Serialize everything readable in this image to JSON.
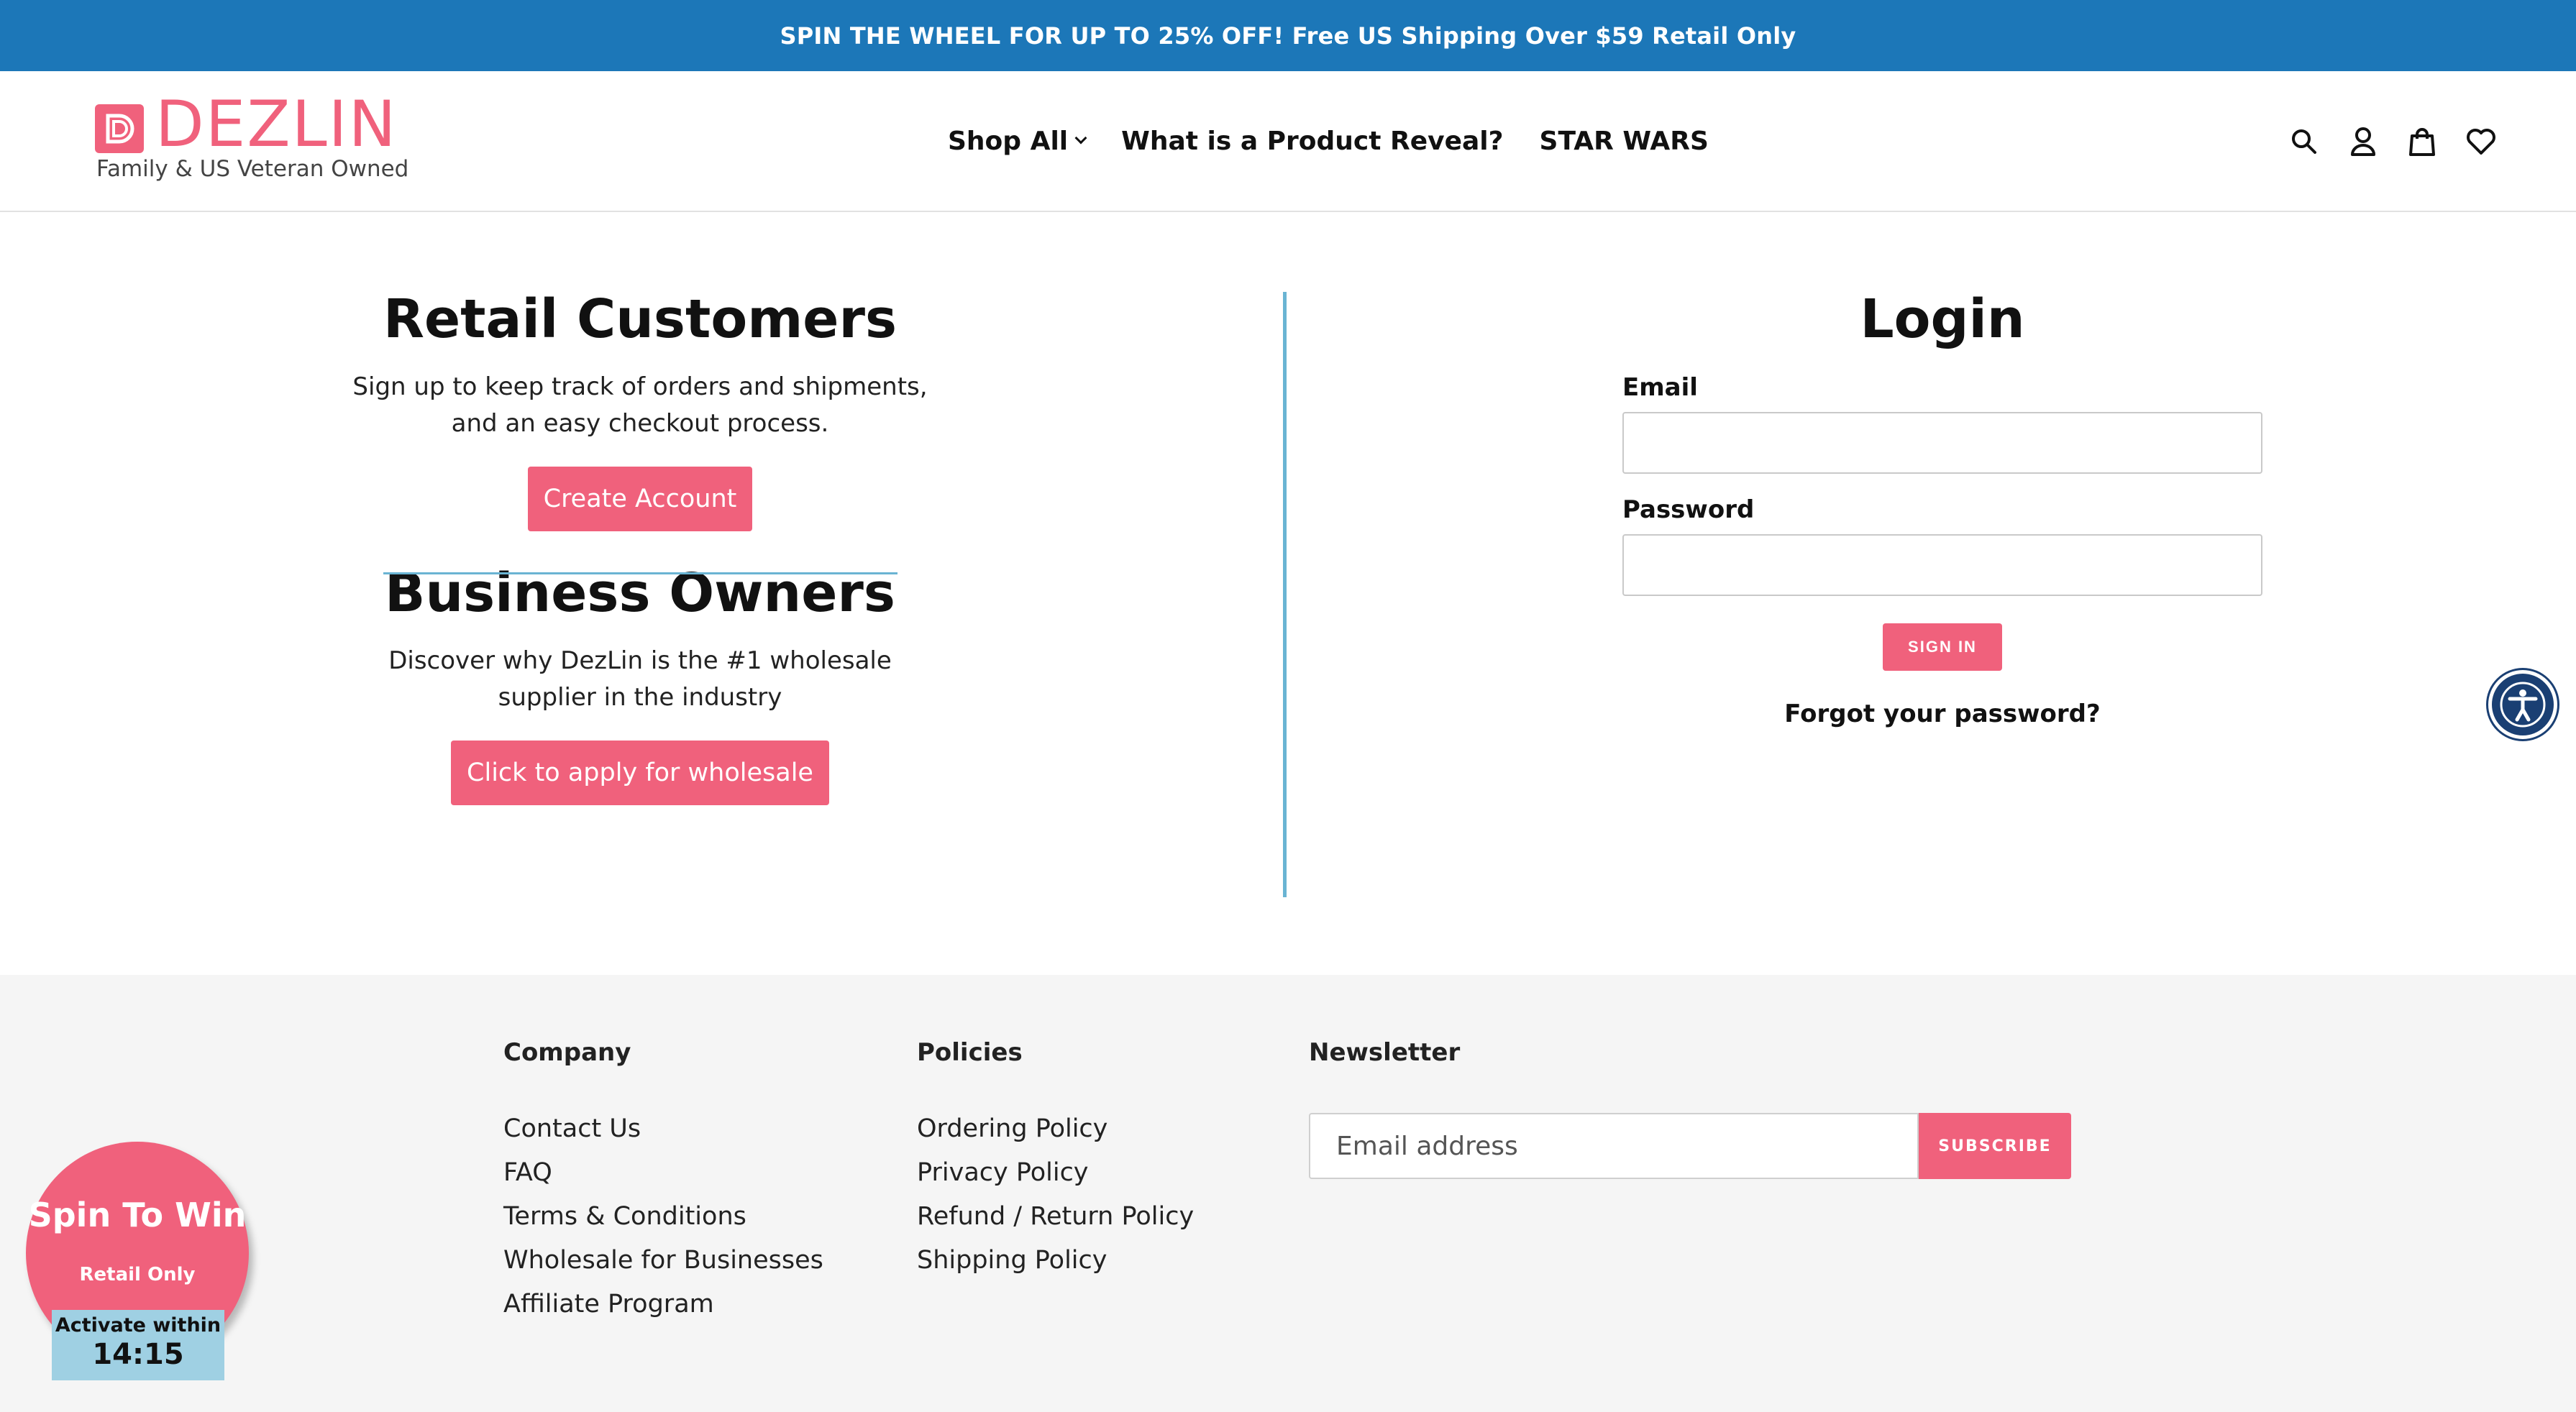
{
  "announcement": "SPIN THE WHEEL FOR UP TO 25% OFF! Free US Shipping Over $59 Retail Only",
  "logo": {
    "name": "DEZLIN",
    "tagline": "Family & US Veteran Owned"
  },
  "nav": {
    "shop_all": "Shop All",
    "product_reveal": "What is a Product Reveal?",
    "star_wars": "STAR WARS"
  },
  "header_icons": [
    "search-icon",
    "account-icon",
    "cart-icon",
    "wishlist-heart-icon"
  ],
  "retail": {
    "title": "Retail Customers",
    "text": "Sign up to keep track of orders and shipments, and an easy checkout process.",
    "button": "Create Account"
  },
  "business": {
    "title": "Business Owners",
    "text": "Discover why DezLin is the #1 wholesale supplier in the industry",
    "button": "Click to apply for wholesale"
  },
  "login": {
    "title": "Login",
    "email_label": "Email",
    "email_value": "",
    "password_label": "Password",
    "password_value": "",
    "sign_in": "SIGN IN",
    "forgot": "Forgot your password?"
  },
  "footer": {
    "company": {
      "heading": "Company",
      "links": [
        "Contact Us",
        "FAQ",
        "Terms & Conditions",
        "Wholesale for Businesses",
        "Affiliate Program"
      ]
    },
    "policies": {
      "heading": "Policies",
      "links": [
        "Ordering Policy",
        "Privacy Policy",
        "Refund / Return Policy",
        "Shipping Policy"
      ]
    },
    "newsletter": {
      "heading": "Newsletter",
      "placeholder": "Email address",
      "button": "SUBSCRIBE"
    }
  },
  "spin_widget": {
    "title": "Spin To Win",
    "subtitle": "Retail Only",
    "activate_label": "Activate within",
    "timer": "14:15"
  },
  "colors": {
    "announcement_bg": "#1c77b8",
    "accent_pink": "#f0617c",
    "divider_blue": "#6ab4d3",
    "accessibility_bg": "#1a3f73"
  }
}
